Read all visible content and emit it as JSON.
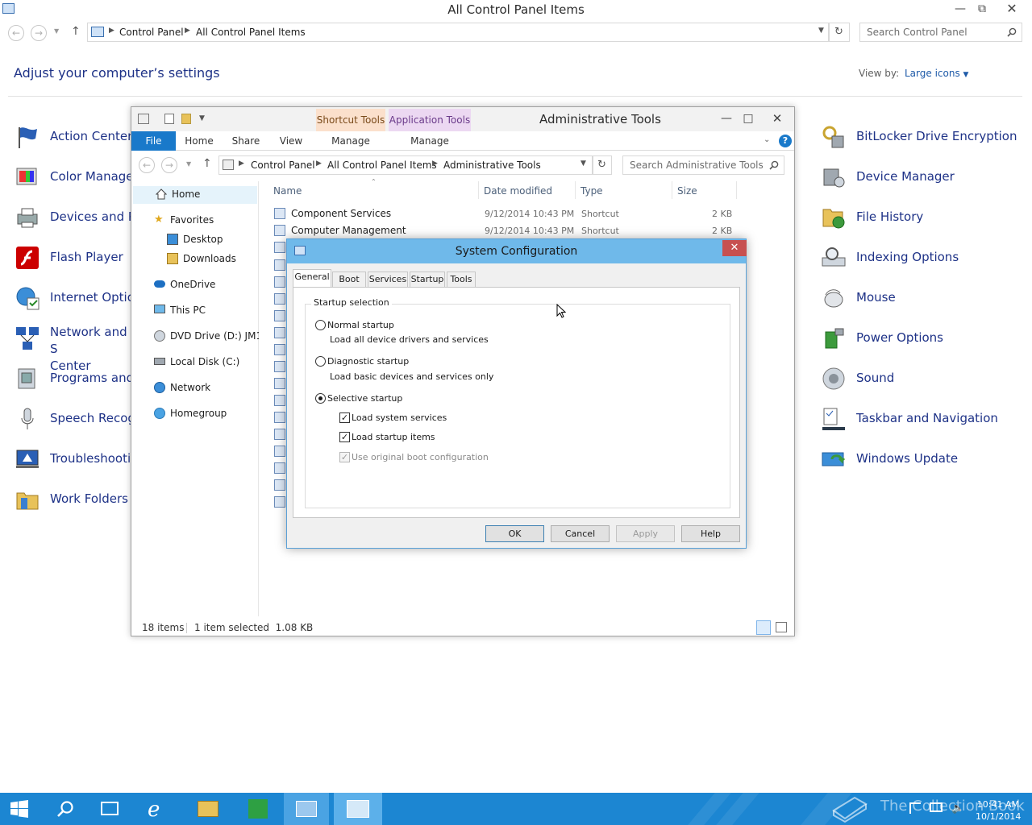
{
  "control_panel": {
    "window_title": "All Control Panel Items",
    "breadcrumb": [
      "Control Panel",
      "All Control Panel Items"
    ],
    "search_placeholder": "Search Control Panel",
    "page_title": "Adjust your computer’s settings",
    "view_by_label": "View by:",
    "view_by_value": "Large icons",
    "left_items": [
      {
        "label": "Action Center",
        "icon": "flag-icon"
      },
      {
        "label": "Color Manage",
        "icon": "color-management-icon"
      },
      {
        "label": "Devices and Pr",
        "icon": "printer-icon"
      },
      {
        "label": "Flash Player",
        "icon": "flash-icon"
      },
      {
        "label": "Internet Optio",
        "icon": "globe-icon"
      },
      {
        "label": "Network and S",
        "label2": "Center",
        "icon": "network-icon"
      },
      {
        "label": "Programs and",
        "icon": "programs-icon"
      },
      {
        "label": "Speech Recogn",
        "icon": "microphone-icon"
      },
      {
        "label": "Troubleshootin",
        "icon": "troubleshoot-icon"
      },
      {
        "label": "Work Folders",
        "icon": "folder-icon"
      }
    ],
    "right_items": [
      {
        "label": "BitLocker Drive Encryption",
        "icon": "bitlocker-icon"
      },
      {
        "label": "Device Manager",
        "icon": "device-manager-icon"
      },
      {
        "label": "File History",
        "icon": "file-history-icon"
      },
      {
        "label": "Indexing Options",
        "icon": "indexing-icon"
      },
      {
        "label": "Mouse",
        "icon": "mouse-icon"
      },
      {
        "label": "Power Options",
        "icon": "power-icon"
      },
      {
        "label": "Sound",
        "icon": "speaker-icon"
      },
      {
        "label": "Taskbar and Navigation",
        "icon": "taskbar-icon"
      },
      {
        "label": "Windows Update",
        "icon": "windows-update-icon"
      }
    ]
  },
  "admin_tools": {
    "window_title": "Administrative Tools",
    "context_tabs": [
      "Shortcut Tools",
      "Application Tools"
    ],
    "ribbon_tabs": [
      "File",
      "Home",
      "Share",
      "View",
      "Manage",
      "Manage"
    ],
    "breadcrumb": [
      "Control Panel",
      "All Control Panel Items",
      "Administrative Tools"
    ],
    "search_placeholder": "Search Administrative Tools",
    "nav": [
      {
        "label": "Home",
        "icon": "home-icon"
      },
      {
        "label": "Favorites",
        "icon": "star-icon"
      },
      {
        "label": "Desktop",
        "icon": "desktop-icon"
      },
      {
        "label": "Downloads",
        "icon": "downloads-icon"
      },
      {
        "label": "OneDrive",
        "icon": "cloud-icon"
      },
      {
        "label": "This PC",
        "icon": "computer-icon"
      },
      {
        "label": "DVD Drive (D:) JM1_C",
        "icon": "dvd-icon"
      },
      {
        "label": "Local Disk (C:)",
        "icon": "disk-icon"
      },
      {
        "label": "Network",
        "icon": "network-icon"
      },
      {
        "label": "Homegroup",
        "icon": "homegroup-icon"
      }
    ],
    "columns": [
      "Name",
      "Date modified",
      "Type",
      "Size"
    ],
    "files": [
      {
        "name": "Component Services",
        "date": "9/12/2014 10:43 PM",
        "type": "Shortcut",
        "size": "2 KB"
      },
      {
        "name": "Computer Management",
        "date": "9/12/2014 10:43 PM",
        "type": "Shortcut",
        "size": "2 KB"
      }
    ],
    "status_count": "18 items",
    "status_selected": "1 item selected  1.08 KB"
  },
  "msconfig": {
    "title": "System Configuration",
    "tabs": [
      "General",
      "Boot",
      "Services",
      "Startup",
      "Tools"
    ],
    "group_label": "Startup selection",
    "normal_label": "Normal startup",
    "normal_desc": "Load all device drivers and services",
    "diagnostic_label": "Diagnostic startup",
    "diagnostic_desc": "Load basic devices and services only",
    "selective_label": "Selective startup",
    "load_system_services": "Load system services",
    "load_startup_items": "Load startup items",
    "use_original_boot": "Use original boot configuration",
    "selected_mode": "selective",
    "buttons": {
      "ok": "OK",
      "cancel": "Cancel",
      "apply": "Apply",
      "help": "Help"
    }
  },
  "taskbar": {
    "watermark": "The Collection Book",
    "time": "10:41 AM",
    "date": "10/1/2014"
  },
  "colors": {
    "taskbar": "#1c86d2",
    "link": "#1e3287",
    "dialog_titlebar": "#6fb9ea",
    "file_tab": "#1979ca"
  }
}
